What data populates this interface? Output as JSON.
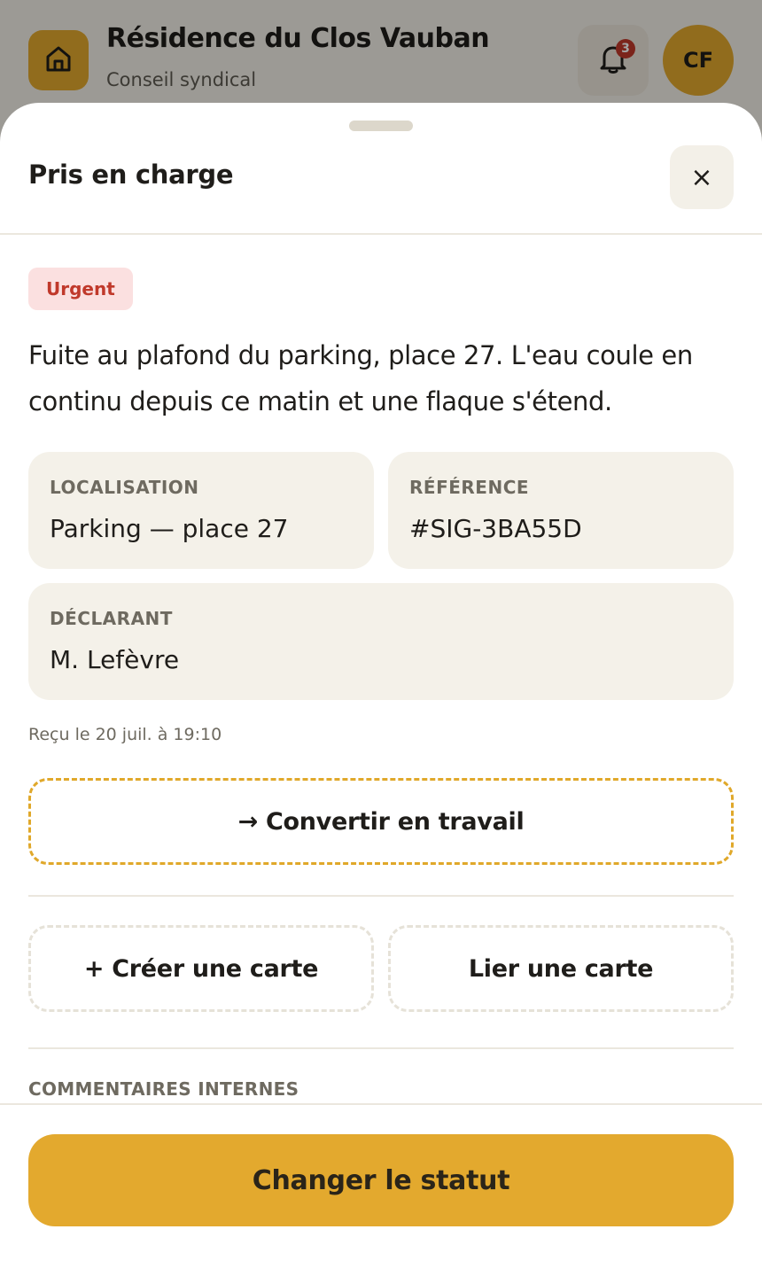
{
  "app": {
    "title": "Résidence du Clos Vauban",
    "subtitle": "Conseil syndical",
    "notifications_count": "3",
    "avatar_initials": "CF"
  },
  "sheet": {
    "title": "Pris en charge",
    "close_label": "×",
    "priority_badge": "Urgent",
    "description": "Fuite au plafond du parking, place 27. L'eau coule en continu depuis ce matin et une flaque s'étend.",
    "fields": {
      "location_label": "LOCALISATION",
      "location_value": "Parking — place 27",
      "reference_label": "RÉFÉRENCE",
      "reference_value": "#SIG-3BA55D",
      "reporter_label": "DÉCLARANT",
      "reporter_value": "M. Lefèvre"
    },
    "received": "Reçu le 20 juil. à 19:10",
    "convert_label": "→ Convertir en travail",
    "create_card_label": "+ Créer une carte",
    "link_card_label": "Lier une carte",
    "comments_section_label": "COMMENTAIRES INTERNES",
    "change_status_label": "Changer le statut"
  },
  "icons": {
    "home": "home-icon",
    "bell": "bell-icon",
    "close": "close-icon"
  },
  "colors": {
    "accent": "#e3a92e",
    "urgent_text": "#c0392b",
    "urgent_bg": "#fbe0e0",
    "card_bg": "#f4f1e9"
  }
}
